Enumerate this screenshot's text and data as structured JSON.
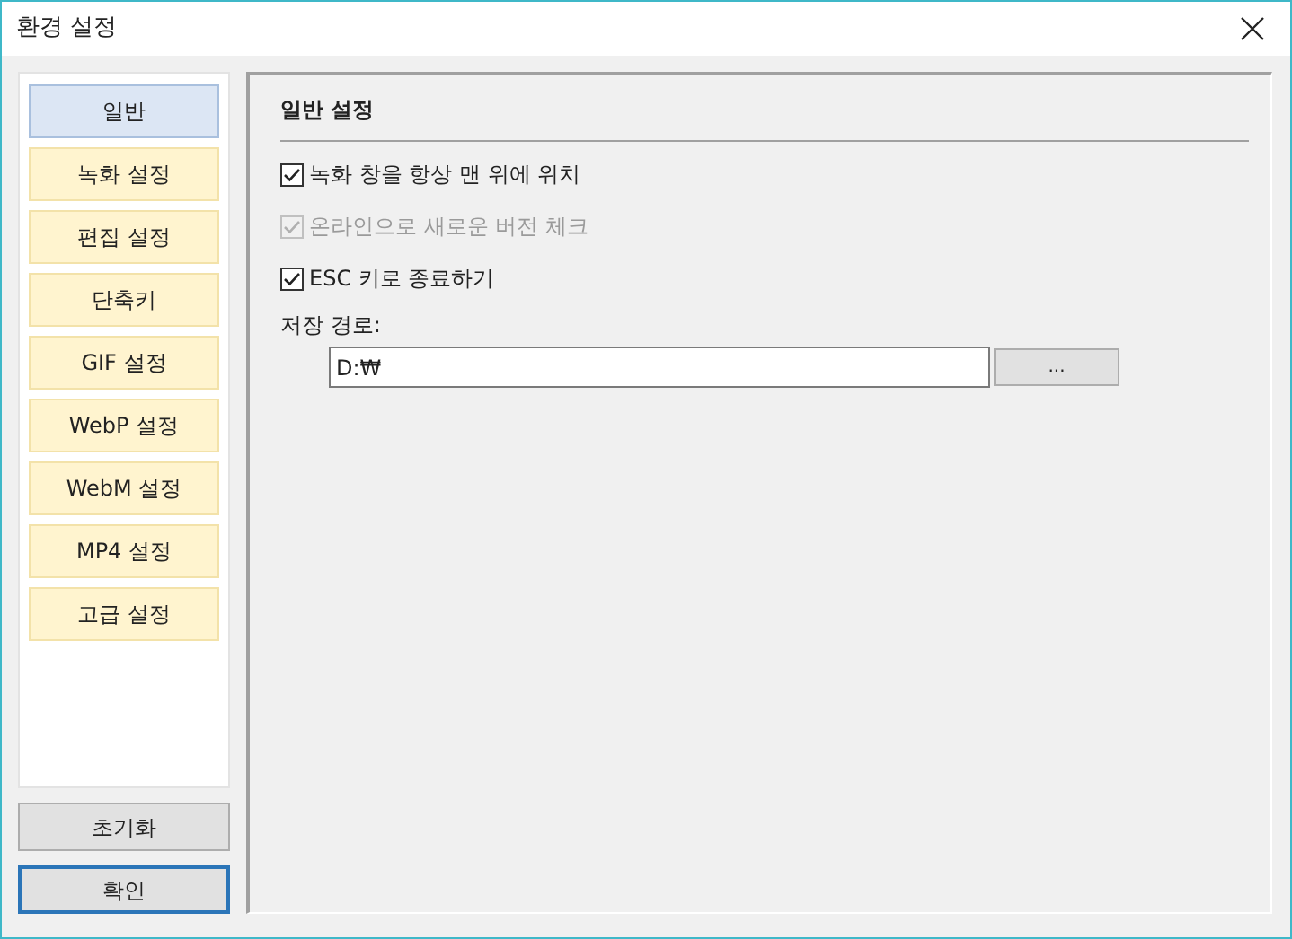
{
  "window": {
    "title": "환경 설정"
  },
  "sidebar": {
    "items": [
      {
        "label": "일반",
        "selected": true
      },
      {
        "label": "녹화 설정",
        "selected": false
      },
      {
        "label": "편집 설정",
        "selected": false
      },
      {
        "label": "단축키",
        "selected": false
      },
      {
        "label": "GIF 설정",
        "selected": false
      },
      {
        "label": "WebP 설정",
        "selected": false
      },
      {
        "label": "WebM 설정",
        "selected": false
      },
      {
        "label": "MP4 설정",
        "selected": false
      },
      {
        "label": "고급 설정",
        "selected": false
      }
    ]
  },
  "bottom_buttons": [
    {
      "label": "초기화",
      "focused": false
    },
    {
      "label": "확인",
      "focused": true
    }
  ],
  "panel": {
    "title": "일반 설정",
    "options": [
      {
        "label": "녹화 창을 항상 맨 위에 위치",
        "checked": true,
        "disabled": false
      },
      {
        "label": "온라인으로 새로운 버전 체크",
        "checked": true,
        "disabled": true
      },
      {
        "label": "ESC 키로 종료하기",
        "checked": true,
        "disabled": false
      }
    ],
    "save_path": {
      "label": "저장 경로:",
      "value": "D:₩",
      "browse": "..."
    }
  }
}
